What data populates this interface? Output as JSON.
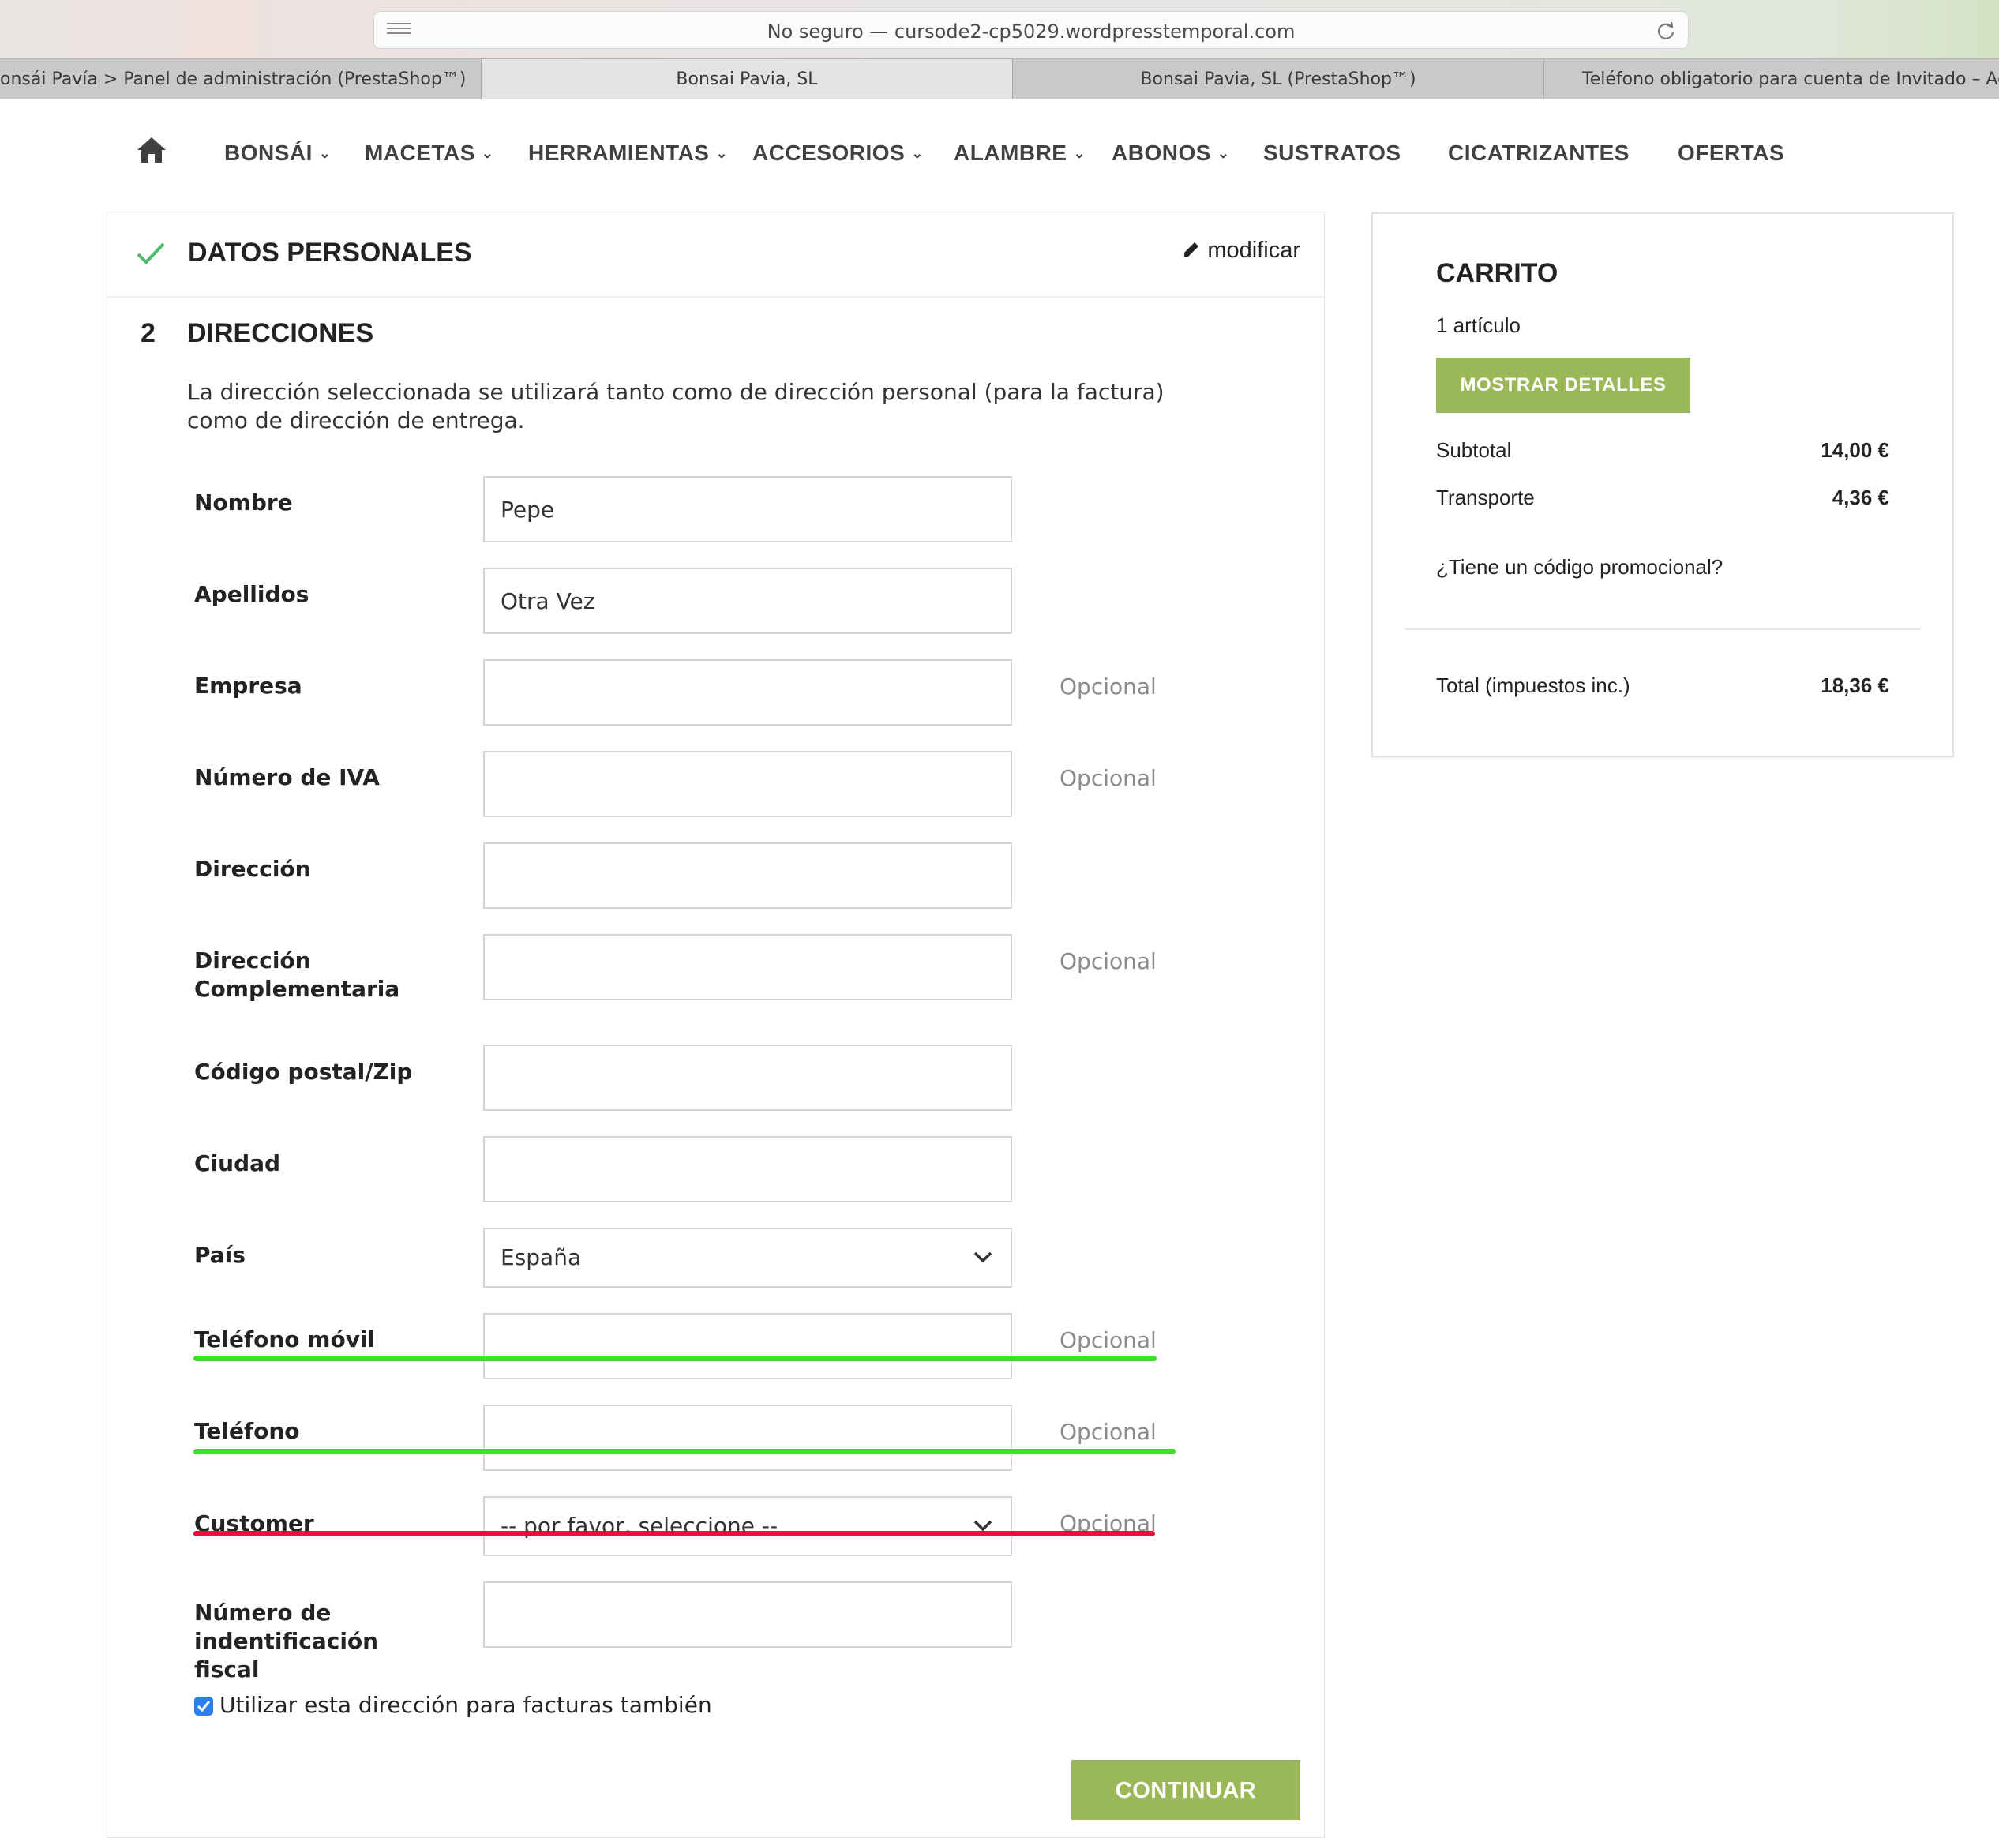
{
  "browser": {
    "url": "No seguro — cursode2-cp5029.wordpresstemporal.com",
    "tabs": [
      {
        "label": "onsái Pavía > Panel de administración (PrestaShop™)"
      },
      {
        "label": "Bonsai Pavia, SL"
      },
      {
        "label": "Bonsai Pavia, SL (PrestaShop™)"
      },
      {
        "label": "Teléfono obligatorio para cuenta de Invitado – Admin"
      }
    ]
  },
  "nav": {
    "items": [
      {
        "label": "BONSÁI",
        "dropdown": true
      },
      {
        "label": "MACETAS",
        "dropdown": true
      },
      {
        "label": "HERRAMIENTAS",
        "dropdown": true
      },
      {
        "label": "ACCESORIOS",
        "dropdown": true
      },
      {
        "label": "ALAMBRE",
        "dropdown": true
      },
      {
        "label": "ABONOS",
        "dropdown": true
      },
      {
        "label": "SUSTRATOS",
        "dropdown": false
      },
      {
        "label": "CICATRIZANTES",
        "dropdown": false
      },
      {
        "label": "OFERTAS",
        "dropdown": false
      }
    ],
    "chevron": "⌄"
  },
  "checkout": {
    "step1": {
      "title": "DATOS PERSONALES",
      "edit_label": "modificar"
    },
    "step2": {
      "number": "2",
      "title": "DIRECCIONES",
      "intro": "La dirección seleccionada se utilizará tanto como de dirección personal (para la factura) como de dirección de entrega."
    },
    "optional_label": "Opcional",
    "fields": {
      "nombre": {
        "label": "Nombre",
        "value": "Pepe"
      },
      "apellidos": {
        "label": "Apellidos",
        "value": "Otra Vez"
      },
      "empresa": {
        "label": "Empresa",
        "value": ""
      },
      "iva": {
        "label": "Número de IVA",
        "value": ""
      },
      "direccion": {
        "label": "Dirección",
        "value": ""
      },
      "direccion2": {
        "label": "Dirección Complementaria",
        "value": ""
      },
      "cp": {
        "label": "Código postal/Zip",
        "value": ""
      },
      "ciudad": {
        "label": "Ciudad",
        "value": ""
      },
      "pais": {
        "label": "País",
        "value": "España"
      },
      "movil": {
        "label": "Teléfono móvil",
        "value": ""
      },
      "telefono": {
        "label": "Teléfono",
        "value": ""
      },
      "customer": {
        "label": "Customer",
        "value": "-- por favor, seleccione --"
      },
      "nif": {
        "label": "Número de indentificación fiscal",
        "value": ""
      }
    },
    "use_for_invoice": {
      "label": "Utilizar esta dirección para facturas también",
      "checked": true
    },
    "continue_label": "CONTINUAR"
  },
  "cart": {
    "title": "CARRITO",
    "count": "1 artículo",
    "details_label": "MOSTRAR DETALLES",
    "subtotal_label": "Subtotal",
    "subtotal_value": "14,00 €",
    "shipping_label": "Transporte",
    "shipping_value": "4,36 €",
    "promo_label": "¿Tiene un código promocional?",
    "total_label": "Total (impuestos inc.)",
    "total_value": "18,36 €"
  },
  "colors": {
    "accent": "#9ab857",
    "highlight_green": "#3ee02a",
    "highlight_red": "#e3123d",
    "checkbox": "#2a7ff0"
  }
}
